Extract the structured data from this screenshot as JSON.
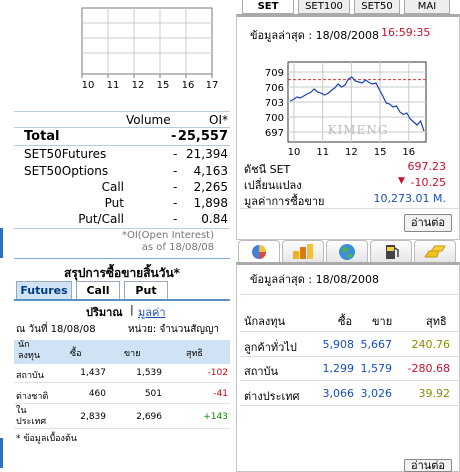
{
  "mini_chart": {
    "x_ticks": [
      "10",
      "11",
      "12",
      "15",
      "16",
      "17"
    ]
  },
  "volume_table": {
    "headers": {
      "volume": "Volume",
      "oi": "OI*"
    },
    "rows": [
      {
        "label": "Total",
        "dash": "-",
        "value": "25,557",
        "bold": true
      },
      {
        "label": "SET50Futures",
        "dash": "-",
        "value": "21,394"
      },
      {
        "label": "SET50Options",
        "dash": "-",
        "value": "4,163"
      },
      {
        "label": "Call",
        "dash": "-",
        "value": "2,265"
      },
      {
        "label": "Put",
        "dash": "-",
        "value": "1,898"
      },
      {
        "label": "Put/Call",
        "dash": "-",
        "value": "0.84"
      }
    ],
    "note_line1": "*OI(Open Interest)",
    "note_line2": "as of 18/08/08"
  },
  "summary": {
    "title": "สรุปการซื้อขายสิ้นวัน*",
    "tabs": [
      "Futures",
      "Call",
      "Put"
    ],
    "active_tab": "Futures",
    "mode_label": "ปริมาณ",
    "mode_sep": "|",
    "mode_link": "มูลค่า",
    "date_label": "ณ วันที่ 18/08/08",
    "unit_label": "หน่วย: จำนวนสัญญา",
    "columns": [
      "นักลงทุน",
      "ซื้อ",
      "ขาย",
      "สุทธิ"
    ],
    "rows": [
      {
        "name": "สถาบัน",
        "buy": "1,437",
        "sell": "1,539",
        "net": "-102",
        "sign": "neg"
      },
      {
        "name": "ต่างชาติ",
        "buy": "460",
        "sell": "501",
        "net": "-41",
        "sign": "neg"
      },
      {
        "name": "ในประเทศ",
        "buy": "2,839",
        "sell": "2,696",
        "net": "+143",
        "sign": "pos"
      }
    ],
    "footnote": "* ข้อมูลเบื้องต้น"
  },
  "index_tabs": [
    "SET",
    "SET100",
    "SET50",
    "MAI"
  ],
  "index_panel": {
    "latest_label": "ข้อมูลล่าสุด : 18/08/2008",
    "latest_time": "16:59:35",
    "chart": {
      "y_ticks": [
        "709",
        "706",
        "703",
        "700",
        "697"
      ],
      "x_ticks": [
        "10",
        "11",
        "12",
        "15",
        "16"
      ],
      "watermark": "KIMENG"
    },
    "stats": [
      {
        "label": "ดัชนี SET",
        "value": "697.23",
        "color": "red"
      },
      {
        "label": "เปลี่ยนแปลง",
        "arrow": "▼",
        "value": "-10.25",
        "color": "red"
      },
      {
        "label": "มูลค่าการซื้อขาย",
        "value": "10,273.01 M.",
        "color": "blue"
      }
    ],
    "more_button": "อ่านต่อ"
  },
  "chart_data": {
    "type": "line",
    "title": "",
    "xlabel": "",
    "ylabel": "",
    "x_ticks": [
      "10",
      "11",
      "12",
      "15",
      "16"
    ],
    "ylim": [
      695,
      711
    ],
    "reference_line": 707.48,
    "series": [
      {
        "values": [
          703.2,
          703.5,
          704.0,
          703.8,
          704.2,
          704.6,
          704.9,
          705.6,
          705.0,
          704.8,
          704.4,
          704.7,
          705.3,
          705.8,
          706.6,
          706.0,
          706.4,
          707.6,
          708.0,
          707.2,
          707.0,
          706.8,
          707.4,
          706.9,
          706.6,
          706.8,
          705.5,
          704.2,
          702.8,
          702.6,
          702.0,
          702.2,
          701.0,
          700.5,
          700.8,
          699.6,
          699.0,
          698.4,
          699.2,
          697.2
        ]
      }
    ]
  },
  "investor_panel": {
    "icon_tabs": [
      "pie-chart-icon",
      "bars-icon",
      "globe-icon",
      "gas-pump-icon",
      "gold-bars-icon"
    ],
    "latest_label": "ข้อมูลล่าสุด : 18/08/2008",
    "columns": [
      "นักลงทุน",
      "ซื้อ",
      "ขาย",
      "สุทธิ"
    ],
    "rows": [
      {
        "name": "ลูกค้าทั่วไป",
        "buy": "5,908",
        "sell": "5,667",
        "net": "240.76",
        "sign": "pos"
      },
      {
        "name": "สถาบัน",
        "buy": "1,299",
        "sell": "1,579",
        "net": "-280.68",
        "sign": "neg"
      },
      {
        "name": "ต่างประเทศ",
        "buy": "3,066",
        "sell": "3,026",
        "net": "39.92",
        "sign": "pos"
      }
    ],
    "more_button": "อ่านต่อ"
  },
  "colors": {
    "accent": "#2f6fc6",
    "negative": "#d10000",
    "positive": "#0a8a0a",
    "net_positive": "#8a8a00",
    "value_blue": "#1a4fb8"
  }
}
